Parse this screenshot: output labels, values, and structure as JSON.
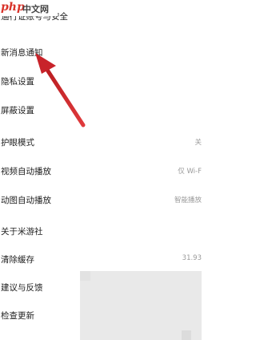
{
  "watermark": {
    "php": "php",
    "cn": "中文网",
    "com": ""
  },
  "settings": [
    {
      "label": "通行证账号与安全",
      "value": ""
    },
    {
      "label": "新消息通知",
      "value": ""
    },
    {
      "label": "隐私设置",
      "value": ""
    },
    {
      "label": "屏蔽设置",
      "value": ""
    },
    {
      "label": "护眼模式",
      "value": "关"
    },
    {
      "label": "视频自动播放",
      "value": "仅 Wi-F"
    },
    {
      "label": "动图自动播放",
      "value": "智能播放"
    },
    {
      "label": "关于米游社",
      "value": ""
    },
    {
      "label": "清除缓存",
      "value": "31.93"
    },
    {
      "label": "建议与反馈",
      "value": ""
    },
    {
      "label": "检查更新",
      "value": ""
    }
  ],
  "annotation": {
    "color": "#d4272a"
  }
}
